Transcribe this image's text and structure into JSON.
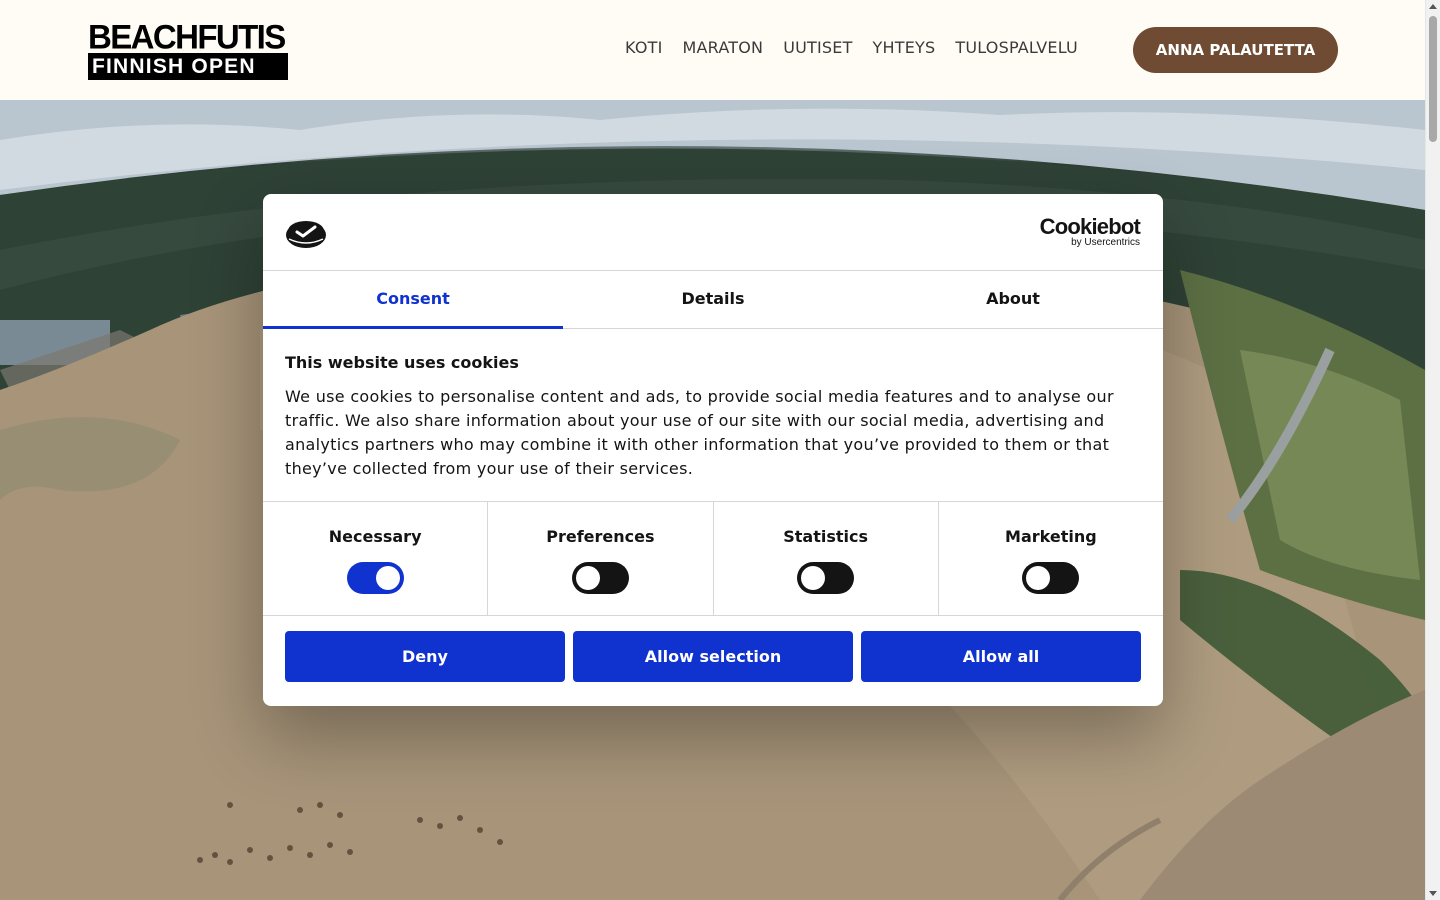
{
  "logo": {
    "line1": "BEACHFUTIS",
    "line2": "FINNISH OPEN"
  },
  "nav": [
    {
      "label": "KOTI"
    },
    {
      "label": "MARATON"
    },
    {
      "label": "UUTISET"
    },
    {
      "label": "YHTEYS"
    },
    {
      "label": "TULOSPALVELU"
    }
  ],
  "cta_label": "ANNA PALAUTETTA",
  "cookie_dialog": {
    "brand_name": "Cookiebot",
    "brand_sub": "by Usercentrics",
    "tabs": [
      {
        "label": "Consent",
        "active": true
      },
      {
        "label": "Details",
        "active": false
      },
      {
        "label": "About",
        "active": false
      }
    ],
    "title": "This website uses cookies",
    "text": "We use cookies to personalise content and ads, to provide social media features and to analyse our traffic. We also share information about your use of our site with our social media, advertising and analytics partners who may combine it with other information that you’ve provided to them or that they’ve collected from your use of their services.",
    "categories": [
      {
        "label": "Necessary",
        "enabled": true
      },
      {
        "label": "Preferences",
        "enabled": false
      },
      {
        "label": "Statistics",
        "enabled": false
      },
      {
        "label": "Marketing",
        "enabled": false
      }
    ],
    "buttons": {
      "deny": "Deny",
      "allow_selection": "Allow selection",
      "allow_all": "Allow all"
    },
    "accent_color": "#1032cf"
  },
  "colors": {
    "header_bg": "#fffcf5",
    "cta_bg": "#6e4b32"
  }
}
